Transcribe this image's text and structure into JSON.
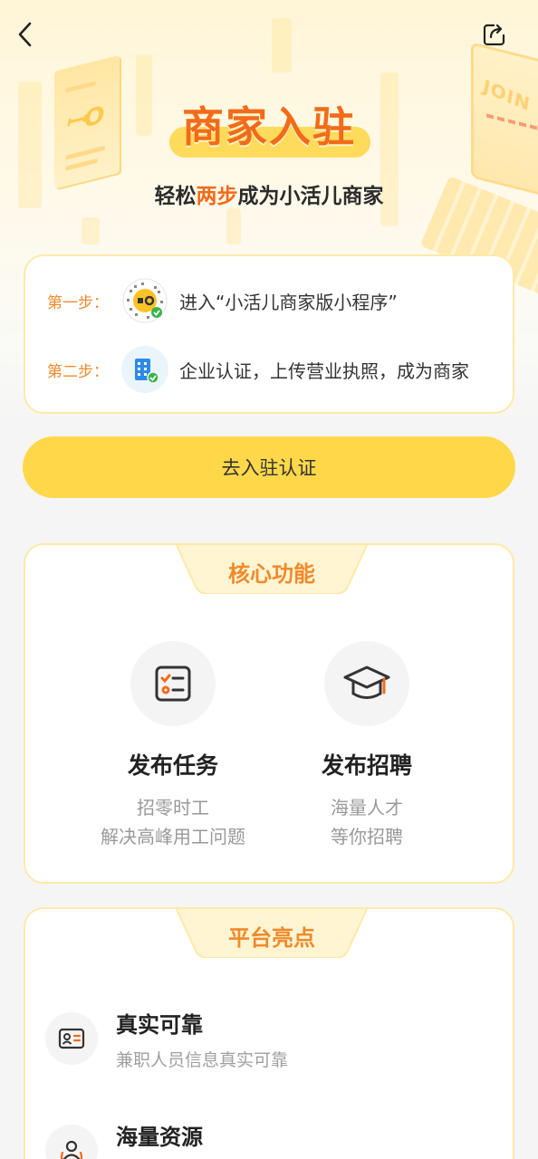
{
  "header": {
    "title": "商家入驻",
    "subtitle_prefix": "轻松",
    "subtitle_highlight": "两步",
    "subtitle_suffix": "成为小活儿商家"
  },
  "nav": {
    "back_icon": "chevron-left-icon",
    "share_icon": "share-icon"
  },
  "steps": [
    {
      "label": "第一步：",
      "icon": "miniprogram-qrcode-icon",
      "text": "进入“小活儿商家版小程序”"
    },
    {
      "label": "第二步：",
      "icon": "enterprise-verify-icon",
      "text": "企业认证，上传营业执照，成为商家"
    }
  ],
  "cta": {
    "label": "去入驻认证"
  },
  "core": {
    "title": "核心功能",
    "features": [
      {
        "icon": "task-list-icon",
        "title": "发布任务",
        "line1": "招零时工",
        "line2": "解决高峰用工问题"
      },
      {
        "icon": "graduation-cap-icon",
        "title": "发布招聘",
        "line1": "海量人才",
        "line2": "等你招聘"
      }
    ]
  },
  "highlights": {
    "title": "平台亮点",
    "items": [
      {
        "icon": "id-card-icon",
        "title": "真实可靠",
        "sub": "兼职人员信息真实可靠"
      },
      {
        "icon": "people-icon",
        "title": "海量资源",
        "sub": ""
      }
    ]
  },
  "colors": {
    "accent": "#f26b1a",
    "orange_label": "#f08a2b",
    "button": "#ffd84a",
    "card_border": "#ffe9a8"
  }
}
